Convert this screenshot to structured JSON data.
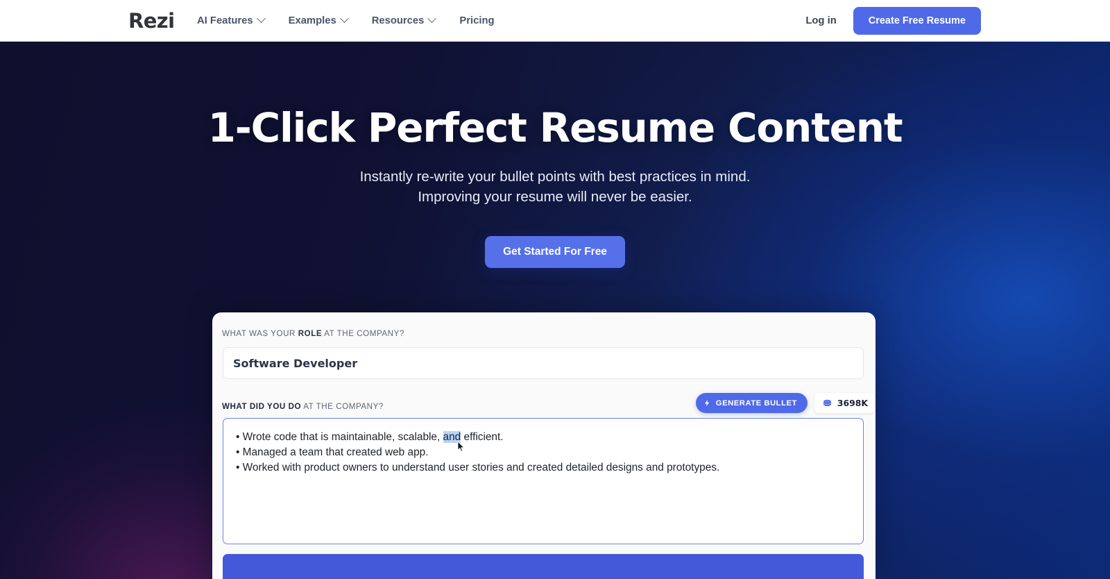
{
  "header": {
    "logo_text": "Rezi",
    "nav_items": [
      {
        "label": "AI Features",
        "has_dropdown": true
      },
      {
        "label": "Examples",
        "has_dropdown": true
      },
      {
        "label": "Resources",
        "has_dropdown": true
      },
      {
        "label": "Pricing",
        "has_dropdown": false
      }
    ],
    "login_label": "Log in",
    "cta_label": "Create Free Resume"
  },
  "hero": {
    "title": "1-Click Perfect Resume Content",
    "subtitle_line1": "Instantly re-write your bullet points with best practices in mind.",
    "subtitle_line2": "Improving your resume will never be easier.",
    "cta_label": "Get Started For Free",
    "bg_dark": "#100f2e",
    "bg_blue": "#0b2a76",
    "bg_purple_glow": "#781e6e"
  },
  "card": {
    "role_label_prefix": "WHAT WAS YOUR ",
    "role_label_strong": "ROLE",
    "role_label_suffix": " AT THE COMPANY?",
    "role_value": "Software Developer",
    "do_label_strong": "WHAT DID YOU DO",
    "do_label_suffix": " AT THE COMPANY?",
    "generate_button_label": "GENERATE BULLET",
    "generate_icon": "bolt-icon",
    "credits_value": "3698K",
    "credits_icon": "coin-icon",
    "bullets": {
      "line1_pre": "• Wrote code that is maintainable, scalable, ",
      "line1_selected": "and",
      "line1_post": " efficient.",
      "line2": "• Managed a team that created web app.",
      "line3": "• Worked with product owners to understand user stories and created detailed designs and prototypes."
    },
    "accent_color": "#4f6ae8",
    "selection_color": "#b6d5f7",
    "bottom_bar_color": "#4359d9"
  }
}
